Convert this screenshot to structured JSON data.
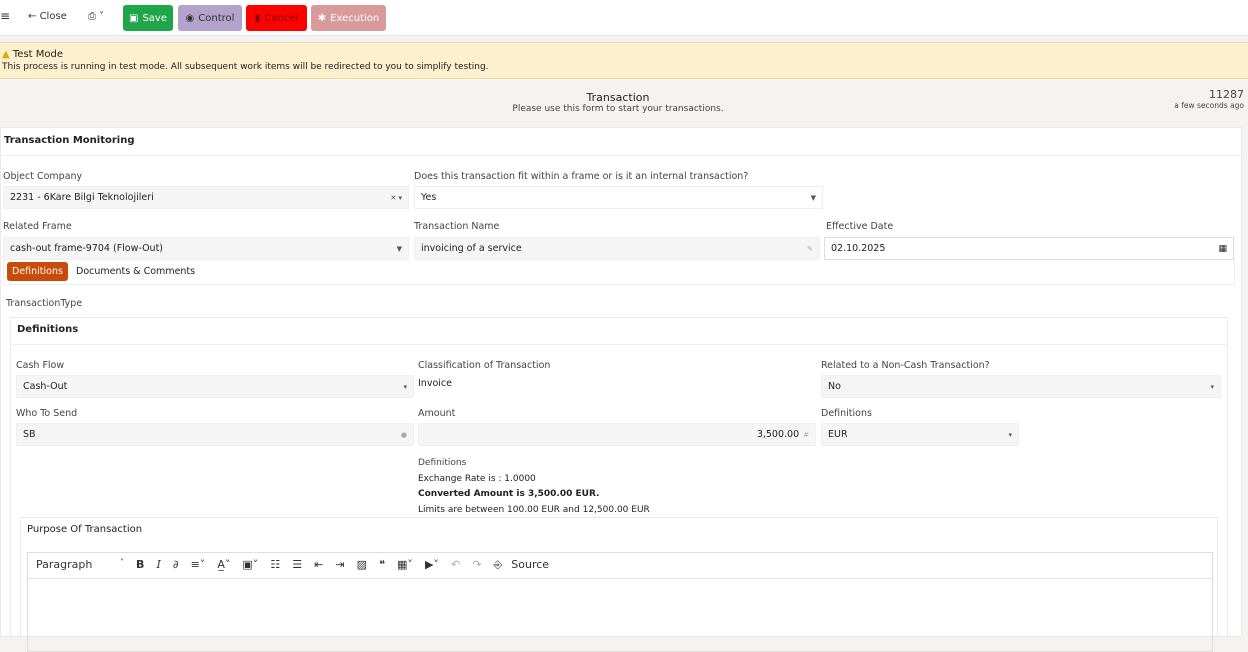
{
  "toolbar": {
    "close": "Close",
    "save": "Save",
    "control": "Control",
    "cancel": "Cancel",
    "execution": "Execution"
  },
  "banner": {
    "title": "Test Mode",
    "text": "This process is running in test mode. All subsequent work items will be redirected to you to simplify testing."
  },
  "header": {
    "title": "Transaction",
    "subtitle": "Please use this form to start your transactions.",
    "id": "11287",
    "time": "a few seconds ago"
  },
  "section": "Transaction Monitoring",
  "fields": {
    "object_company": {
      "label": "Object Company",
      "value": "2231 - 6Kare Bilgi Teknolojileri"
    },
    "frame_fit": {
      "label": "Does this transaction fit within a frame or is it an internal transaction?",
      "value": "Yes"
    },
    "related_frame": {
      "label": "Related Frame",
      "value": "cash-out frame-9704 (Flow-Out)"
    },
    "transaction_name": {
      "label": "Transaction Name",
      "value": "invoicing of a service"
    },
    "effective_date": {
      "label": "Effective Date",
      "value": "02.10.2025"
    }
  },
  "tabs": [
    "Definitions",
    "Documents & Comments"
  ],
  "transaction_type": "TransactionType",
  "definitions": {
    "title": "Definitions",
    "cash_flow": {
      "label": "Cash Flow",
      "value": "Cash-Out"
    },
    "classification": {
      "label": "Classification of Transaction",
      "value": "Invoice"
    },
    "non_cash": {
      "label": "Related to a Non-Cash Transaction?",
      "value": "No"
    },
    "who_to_send": {
      "label": "Who To Send",
      "value": "SB"
    },
    "amount": {
      "label": "Amount",
      "value": "3,500.00"
    },
    "currency": {
      "label": "Definitions",
      "value": "EUR"
    },
    "info_label": "Definitions",
    "exchange": "Exchange Rate is : 1.0000",
    "converted": "Converted Amount is 3,500.00 EUR.",
    "limits": "Limits are between 100.00 EUR and 12,500.00 EUR"
  },
  "purpose": {
    "title": "Purpose Of Transaction",
    "paragraph": "Paragraph",
    "source": "Source"
  }
}
